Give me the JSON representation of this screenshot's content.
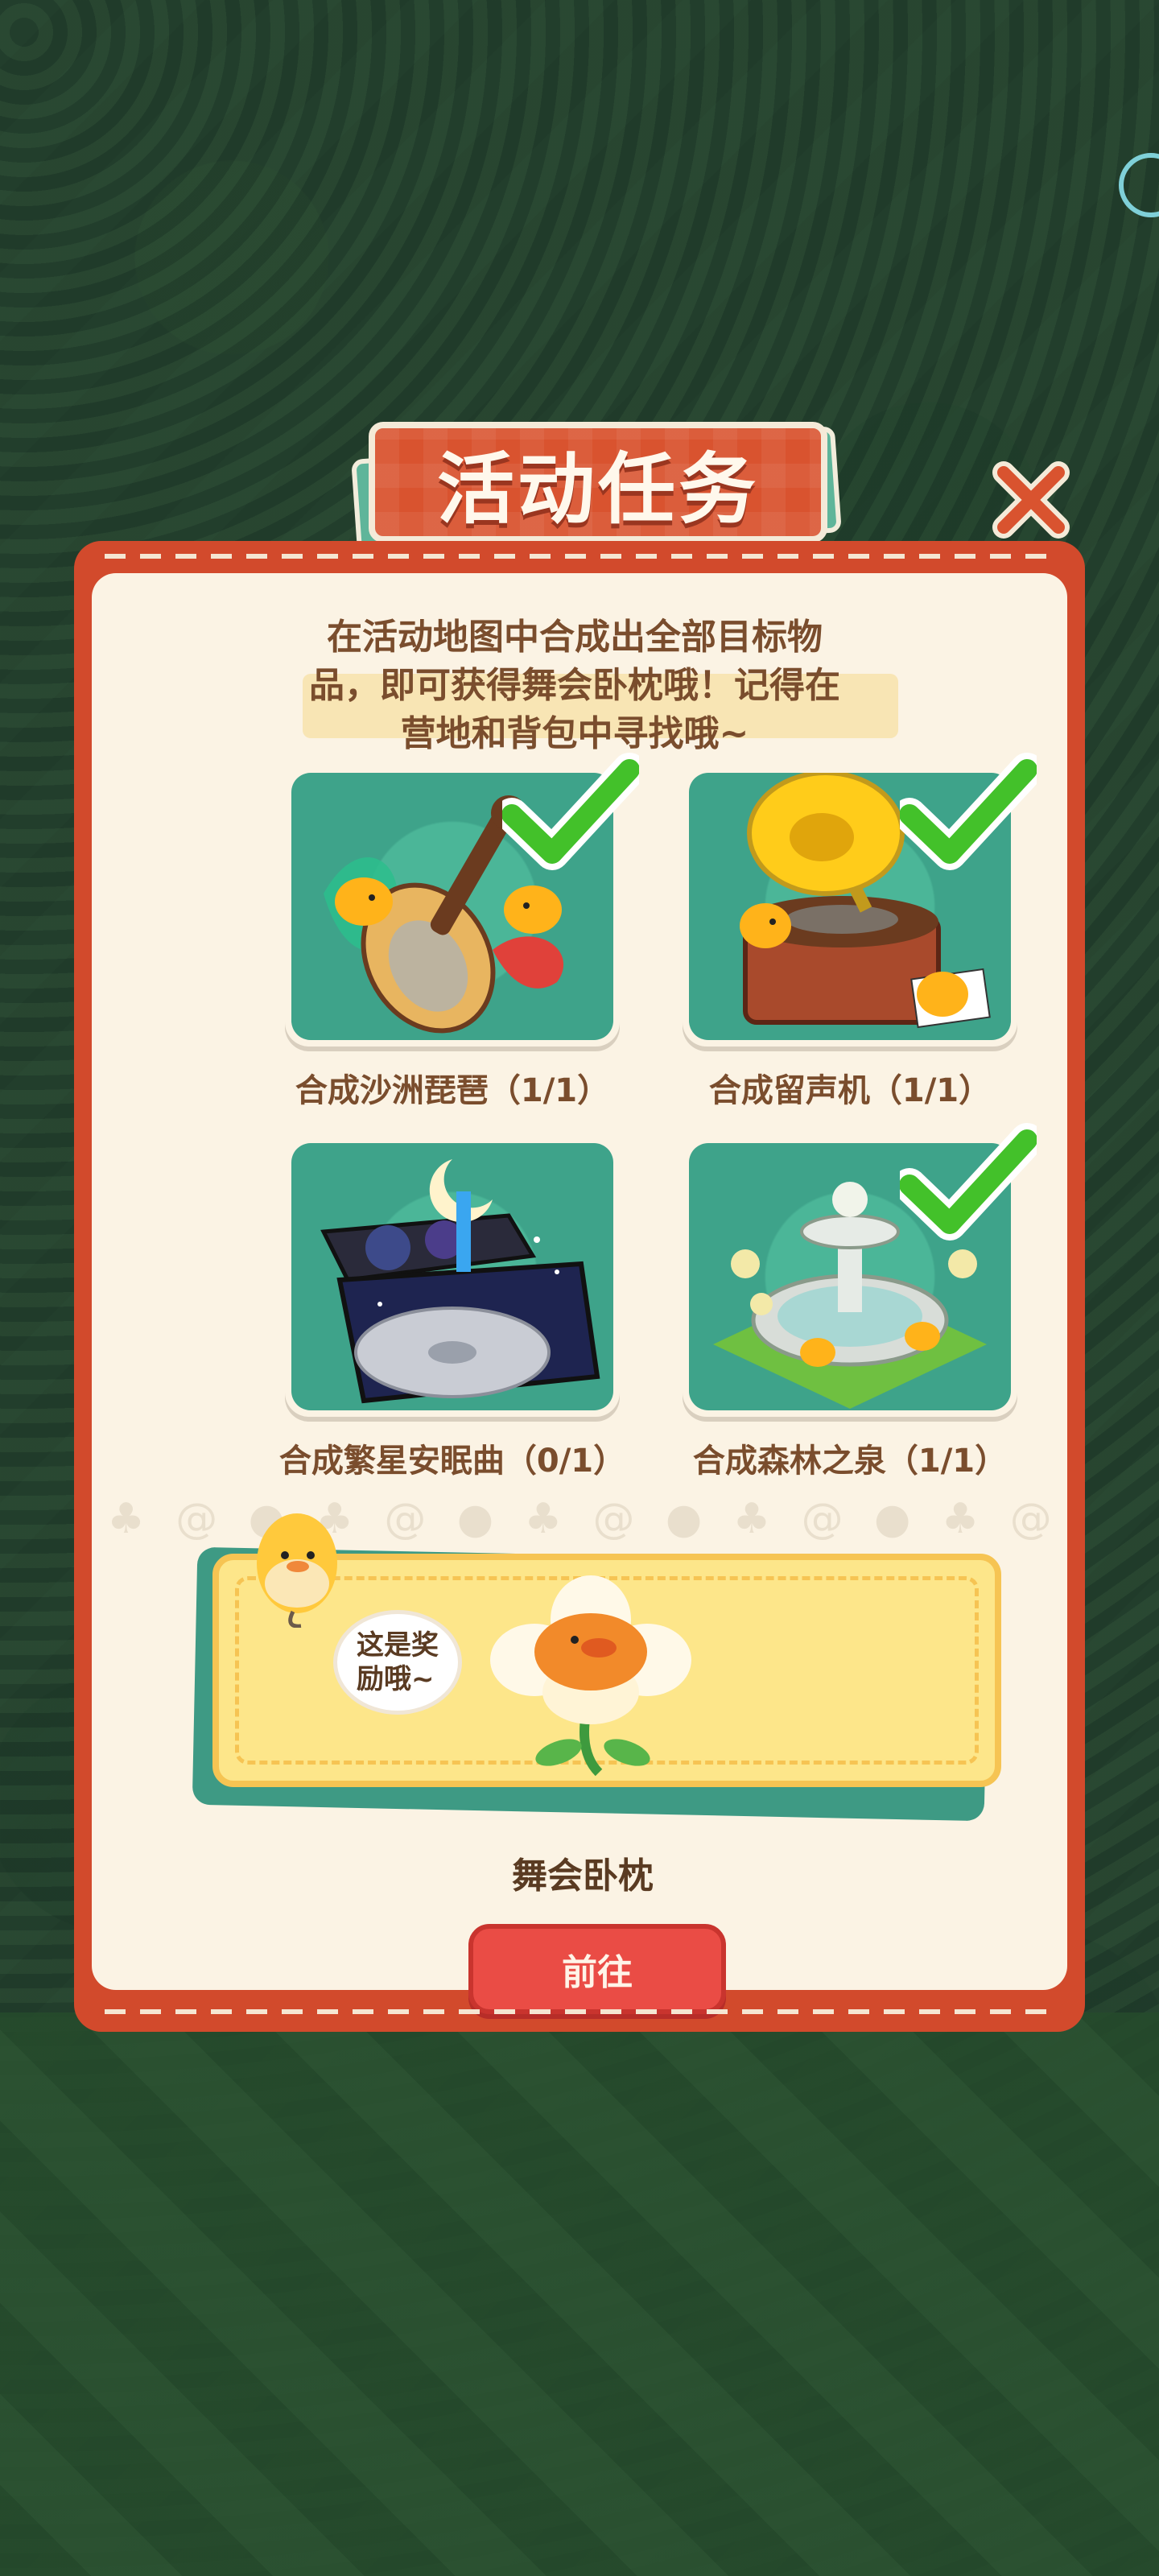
{
  "title": "活动任务",
  "description": "在活动地图中合成出全部目标物品，即可获得舞会卧枕哦！记得在营地和背包中寻找哦~",
  "description_lines": [
    "在活动地图中合成出全部目标物",
    "品，即可获得舞会卧枕哦！记得在",
    "营地和背包中寻找哦~"
  ],
  "tasks": [
    {
      "label": "合成沙洲琵琶（1/1）",
      "completed": true,
      "icon": "pipa-lute-icon"
    },
    {
      "label": "合成留声机（1/1）",
      "completed": true,
      "icon": "gramophone-icon"
    },
    {
      "label": "合成繁星安眠曲（0/1）",
      "completed": false,
      "icon": "starry-lullaby-record-icon"
    },
    {
      "label": "合成森林之泉（1/1）",
      "completed": true,
      "icon": "forest-fountain-icon"
    }
  ],
  "reward": {
    "speech": "这是奖励哦~",
    "speech_lines": [
      "这是奖",
      "励哦~"
    ],
    "name": "舞会卧枕",
    "icon": "flower-chick-pillow-icon"
  },
  "go_button": "前往",
  "colors": {
    "panel_border": "#d24a2c",
    "panel_bg": "#fbf3e4",
    "card_bg": "#3ea38a",
    "check_green": "#43c12a",
    "text_brown": "#7a4d2d",
    "button_red": "#ea4c45",
    "reward_yellow": "#fde68a"
  }
}
